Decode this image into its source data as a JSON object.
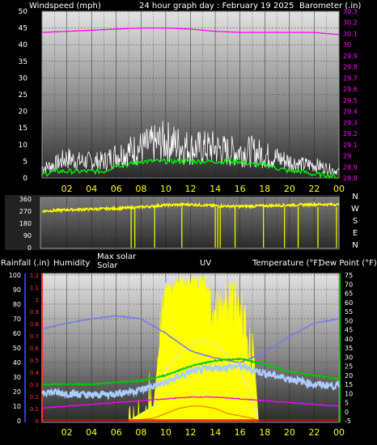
{
  "header": {
    "wind_label": "Windspeed (mph)",
    "graph_title": "24 hour graph day : February 19 2025",
    "baro_label": "Barometer (.in)"
  },
  "compass": [
    "N",
    "W",
    "S",
    "E",
    "N"
  ],
  "legend_bottom": {
    "rainfall": "Rainfall (.in)",
    "humidity": "Humidity",
    "max_solar": "Max solar",
    "solar": "Solar",
    "uv": "UV",
    "temperature": "Temperature (°F)",
    "dew_point": "Dew Point (°F)"
  },
  "colors": {
    "wind": "#ffffff",
    "wind_avg": "#00ff00",
    "barometer": "#ff00ff",
    "wind_dir": "#ffff00",
    "humidity": "#7777ee",
    "rain": "#ff0000",
    "solar": "#ffff00",
    "uv": "#ff7700",
    "temperature": "#00cc00",
    "dew_point": "#ff00ff",
    "apparent": "#aaccff"
  },
  "chart_data": [
    {
      "type": "line",
      "x_ticks": [
        "02",
        "04",
        "06",
        "08",
        "10",
        "12",
        "14",
        "16",
        "18",
        "20",
        "22",
        "00"
      ],
      "ylim_left": [
        0,
        50
      ],
      "y_ticks_left": [
        "0",
        "5",
        "10",
        "15",
        "20",
        "25",
        "30",
        "35",
        "40",
        "45",
        "50"
      ],
      "ylim_right": [
        28.8,
        30.3
      ],
      "y_ticks_right": [
        "28.8",
        "28.9",
        "29",
        "29.1",
        "29.2",
        "29.3",
        "29.4",
        "29.5",
        "29.6",
        "29.7",
        "29.8",
        "29.9",
        "30",
        "30.1",
        "30.2",
        "30.3"
      ],
      "series": [
        {
          "name": "Windspeed (mph)",
          "hours": [
            0,
            1,
            2,
            3,
            4,
            5,
            6,
            7,
            8,
            9,
            10,
            11,
            12,
            13,
            14,
            15,
            16,
            17,
            18,
            19,
            20,
            21,
            22,
            23,
            24
          ],
          "values": [
            3,
            4,
            6,
            5,
            5,
            5,
            7,
            8,
            9,
            10,
            11,
            10,
            9,
            9,
            9,
            8,
            8,
            8,
            7,
            6,
            5,
            4,
            4,
            3,
            2
          ]
        },
        {
          "name": "Wind average",
          "hours": [
            0,
            1,
            2,
            3,
            4,
            5,
            6,
            7,
            8,
            9,
            10,
            11,
            12,
            13,
            14,
            15,
            16,
            17,
            18,
            19,
            20,
            21,
            22,
            23,
            24
          ],
          "values": [
            1,
            2,
            2,
            2,
            2,
            2,
            4,
            4,
            5,
            5,
            5,
            5,
            5,
            5,
            5,
            5,
            5,
            4,
            4,
            3,
            2,
            2,
            1,
            1,
            0
          ]
        },
        {
          "name": "Barometer (.in)",
          "hours": [
            0,
            2,
            4,
            6,
            8,
            10,
            12,
            14,
            16,
            18,
            20,
            22,
            24
          ],
          "values": [
            30.11,
            30.12,
            30.13,
            30.14,
            30.15,
            30.15,
            30.14,
            30.12,
            30.11,
            30.11,
            30.11,
            30.11,
            30.09
          ]
        }
      ]
    },
    {
      "type": "line",
      "x_ticks": [
        "02",
        "04",
        "06",
        "08",
        "10",
        "12",
        "14",
        "16",
        "18",
        "20",
        "22",
        "00"
      ],
      "ylim": [
        0,
        360
      ],
      "y_ticks": [
        "0",
        "90",
        "180",
        "270",
        "360"
      ],
      "series": [
        {
          "name": "Wind direction",
          "hours": [
            0,
            2,
            4,
            6,
            8,
            10,
            12,
            14,
            16,
            18,
            20,
            22,
            24
          ],
          "values": [
            270,
            280,
            285,
            290,
            300,
            315,
            320,
            310,
            305,
            310,
            315,
            320,
            320
          ]
        }
      ]
    },
    {
      "type": "line",
      "x_ticks": [
        "02",
        "04",
        "06",
        "08",
        "10",
        "12",
        "14",
        "16",
        "18",
        "20",
        "22",
        "00"
      ],
      "ylim_humidity": [
        0,
        100
      ],
      "y_ticks_humidity": [
        "0",
        "10",
        "20",
        "30",
        "40",
        "50",
        "60",
        "70",
        "80",
        "90",
        "100"
      ],
      "ylim_rain": [
        0,
        1.2
      ],
      "y_ticks_rain": [
        "0",
        "0.1",
        "0.2",
        "0.3",
        "0.4",
        "0.5",
        "0.6",
        "0.7",
        "0.8",
        "0.9",
        "1",
        "1.1",
        "1.2"
      ],
      "ylim_temp": [
        -5,
        75
      ],
      "y_ticks_temp": [
        "-5",
        "0",
        "5",
        "10",
        "15",
        "20",
        "25",
        "30",
        "35",
        "40",
        "45",
        "50",
        "55",
        "60",
        "65",
        "70",
        "75"
      ],
      "series": [
        {
          "name": "Humidity",
          "hours": [
            0,
            2,
            4,
            6,
            8,
            10,
            12,
            14,
            16,
            18,
            20,
            22,
            24
          ],
          "values": [
            63,
            67,
            70,
            72,
            70,
            60,
            48,
            43,
            40,
            47,
            58,
            67,
            70
          ]
        },
        {
          "name": "Temperature (°F)",
          "hours": [
            0,
            2,
            4,
            6,
            8,
            10,
            12,
            14,
            16,
            18,
            20,
            22,
            24
          ],
          "values": [
            15,
            15,
            15,
            16,
            17,
            20,
            25,
            28,
            29,
            26,
            22,
            20,
            18
          ]
        },
        {
          "name": "Dew Point (°F)",
          "hours": [
            0,
            2,
            4,
            6,
            8,
            10,
            12,
            14,
            16,
            18,
            20,
            22,
            24
          ],
          "values": [
            2,
            3,
            4,
            5,
            6,
            7,
            8,
            8,
            7,
            6,
            5,
            4,
            3
          ]
        },
        {
          "name": "Apparent temperature",
          "hours": [
            0,
            2,
            4,
            6,
            8,
            10,
            12,
            14,
            16,
            18,
            20,
            22,
            24
          ],
          "values": [
            11,
            10,
            9,
            10,
            12,
            16,
            22,
            24,
            25,
            21,
            18,
            15,
            14
          ]
        },
        {
          "name": "Solar",
          "hours": [
            7,
            9,
            10,
            11,
            12,
            13,
            14,
            15,
            16,
            17,
            17.5
          ],
          "values": [
            0,
            10,
            95,
            100,
            100,
            100,
            90,
            95,
            100,
            60,
            0
          ]
        },
        {
          "name": "Max solar",
          "hours": [
            7,
            9,
            10,
            11,
            12,
            13,
            14,
            15,
            16,
            17,
            17.5
          ],
          "values": [
            0,
            10,
            35,
            45,
            52,
            55,
            52,
            45,
            35,
            15,
            0
          ]
        },
        {
          "name": "UV",
          "hours": [
            7,
            9,
            10,
            11,
            12,
            13,
            14,
            15,
            16,
            17,
            17.5
          ],
          "values": [
            0,
            1,
            3,
            5,
            6,
            6,
            5,
            3,
            2,
            1,
            0
          ]
        }
      ]
    }
  ]
}
